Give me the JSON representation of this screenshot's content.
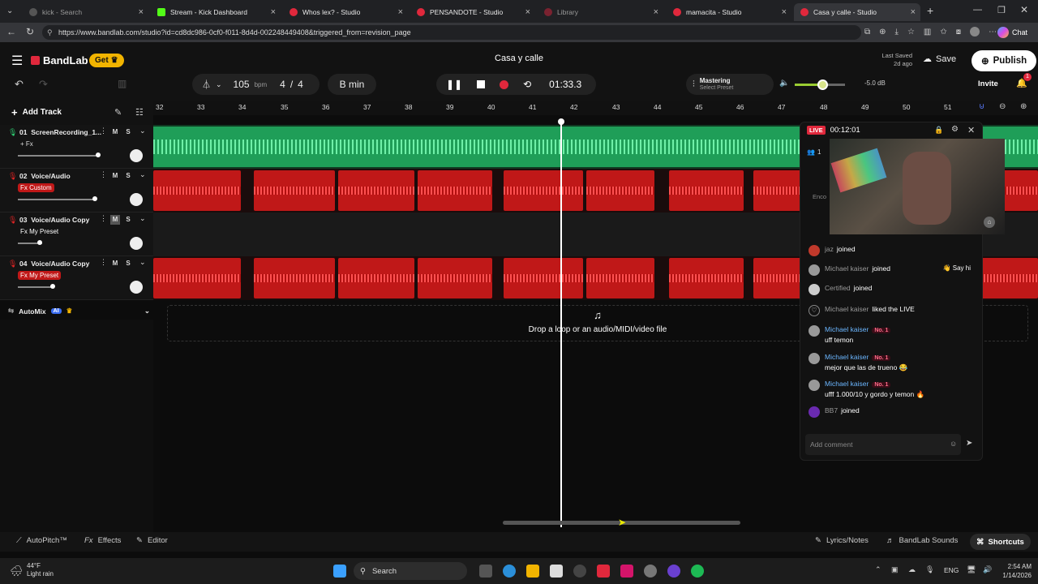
{
  "browser": {
    "tabs": [
      {
        "label": "kick - Search",
        "active": false
      },
      {
        "label": "Stream - Kick Dashboard",
        "active": false
      },
      {
        "label": "Whos lex? - Studio",
        "active": false
      },
      {
        "label": "PENSANDOTE - Studio",
        "active": false
      },
      {
        "label": "Library",
        "active": false
      },
      {
        "label": "mamacita - Studio",
        "active": false
      },
      {
        "label": "Casa y calle - Studio",
        "active": true
      }
    ],
    "url": "https://www.bandlab.com/studio?id=cd8dc986-0cf0-f011-8d4d-002248449408&triggered_from=revision_page",
    "chat_label": "Chat"
  },
  "header": {
    "logo": "BandLab",
    "get_label": "Get",
    "project_title": "Casa y calle",
    "last_saved_label": "Last Saved",
    "last_saved_value": "2d ago",
    "save_label": "Save",
    "publish_label": "Publish",
    "tempo": "105",
    "tempo_unit": "bpm",
    "time_sig_num": "4",
    "time_sig_sep": "/",
    "time_sig_den": "4",
    "key": "B min",
    "time": "01:33.3",
    "mastering_label": "Mastering",
    "mastering_preset": "Select Preset",
    "volume_db": "-5.0 dB",
    "invite_label": "Invite",
    "notif_count": "1"
  },
  "toolbar": {
    "add_track": "Add Track"
  },
  "ruler": [
    "32",
    "33",
    "34",
    "35",
    "36",
    "37",
    "38",
    "39",
    "40",
    "41",
    "42",
    "43",
    "44",
    "45",
    "46",
    "47",
    "48",
    "49",
    "50",
    "51"
  ],
  "tracks": [
    {
      "number": "01",
      "name": "ScreenRecording_1...",
      "fx": "+ Fx",
      "color": "#2ecc71",
      "mute": "M",
      "solo": "S"
    },
    {
      "number": "02",
      "name": "Voice/Audio",
      "fx": "Fx Custom",
      "color": "#e02424",
      "mute": "M",
      "solo": "S"
    },
    {
      "number": "03",
      "name": "Voice/Audio Copy",
      "fx": "Fx My Preset",
      "color": "#e02424",
      "mute": "M",
      "solo": "S"
    },
    {
      "number": "04",
      "name": "Voice/Audio Copy",
      "fx": "Fx My Preset",
      "color": "#e02424",
      "mute": "M",
      "solo": "S"
    }
  ],
  "automix": {
    "label": "AutoMix",
    "ai": "AI"
  },
  "drop_zone": "Drop a loop or an audio/MIDI/video file",
  "live": {
    "badge": "LIVE",
    "timer": "00:12:01",
    "viewers": "1",
    "partial_text": "Enco",
    "chat": [
      {
        "user": "jaz",
        "text": "joined",
        "type": "event"
      },
      {
        "user": "Michael kaiser",
        "text": "joined",
        "type": "event",
        "action": "Say hi"
      },
      {
        "user": "Certified",
        "text": "joined",
        "type": "event"
      },
      {
        "user": "Michael kaiser",
        "text": "liked the LIVE",
        "type": "event"
      },
      {
        "user": "Michael kaiser",
        "badge": "No. 1",
        "text": "uff temon",
        "type": "msg"
      },
      {
        "user": "Michael kaiser",
        "badge": "No. 1",
        "text": "mejor que las de trueno 😂",
        "type": "msg"
      },
      {
        "user": "Michael kaiser",
        "badge": "No. 1",
        "text": "ufff 1.000/10 y gordo y temon 🔥",
        "type": "msg"
      },
      {
        "user": "BB7",
        "text": "joined",
        "type": "event"
      }
    ],
    "comment_placeholder": "Add comment"
  },
  "bottom": {
    "autopitch": "AutoPitch™",
    "effects": "Effects",
    "editor": "Editor",
    "lyrics": "Lyrics/Notes",
    "sounds": "BandLab Sounds",
    "shortcuts": "Shortcuts"
  },
  "taskbar": {
    "temp": "44°F",
    "weather": "Light rain",
    "search": "Search",
    "lang": "ENG",
    "time": "2:54 AM",
    "date": "1/14/2026"
  }
}
